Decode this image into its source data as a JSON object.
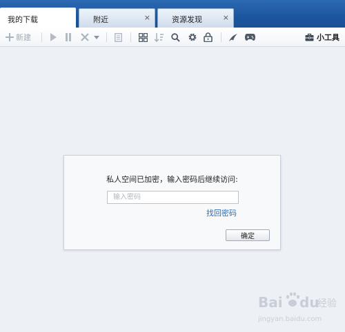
{
  "tabs": [
    {
      "label": "我的下载",
      "active": true
    },
    {
      "label": "附近",
      "close": "×"
    },
    {
      "label": "资源发现",
      "close": "×"
    }
  ],
  "toolbar": {
    "new_label": "新建",
    "tools_label": "小工具",
    "icons": [
      "plus-icon",
      "play-icon",
      "pause-icon",
      "delete-icon",
      "dropdown-arrow-icon",
      "document-icon",
      "grid-view-icon",
      "sort-icon",
      "search-icon",
      "gear-icon",
      "lock-icon",
      "accelerate-icon",
      "gamepad-icon",
      "toolbox-icon"
    ]
  },
  "dialog": {
    "message": "私人空间已加密，输入密码后继续访问:",
    "password_placeholder": "输入密码",
    "password_value": "",
    "recover_link": "找回密码",
    "ok_label": "确定"
  },
  "watermark": {
    "brand": "Bai du 经验",
    "url": "jingyan.baidu.com"
  },
  "colors": {
    "title_bar": "#1d57a0",
    "link": "#2d6db3",
    "background": "#edf0f4"
  }
}
